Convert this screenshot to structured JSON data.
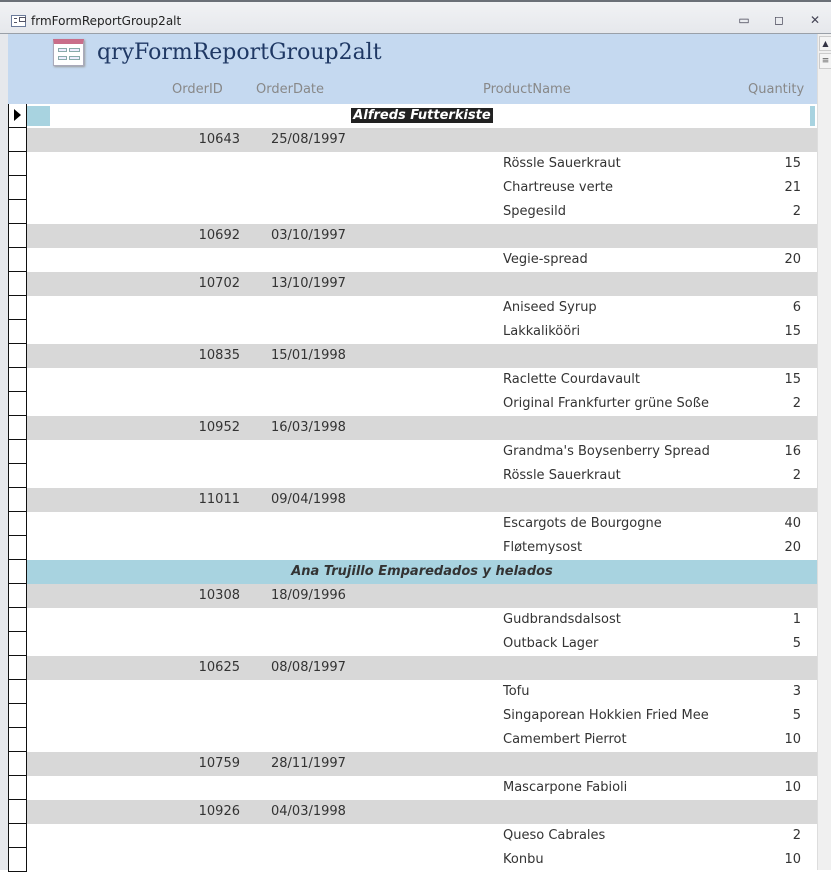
{
  "window": {
    "title": "frmFormReportGroup2alt",
    "minimize": "▭",
    "restore": "◻",
    "close": "✕"
  },
  "header": {
    "title": "qryFormReportGroup2alt",
    "columns": {
      "order_id": "OrderID",
      "order_date": "OrderDate",
      "product": "ProductName",
      "quantity": "Quantity"
    }
  },
  "rows": [
    {
      "type": "customer",
      "name": "Alfreds Futterkiste",
      "active": true
    },
    {
      "type": "order",
      "id": "10643",
      "date": "25/08/1997"
    },
    {
      "type": "detail",
      "product": "Rössle Sauerkraut",
      "qty": "15"
    },
    {
      "type": "detail",
      "product": "Chartreuse verte",
      "qty": "21"
    },
    {
      "type": "detail",
      "product": "Spegesild",
      "qty": "2"
    },
    {
      "type": "order",
      "id": "10692",
      "date": "03/10/1997"
    },
    {
      "type": "detail",
      "product": "Vegie-spread",
      "qty": "20"
    },
    {
      "type": "order",
      "id": "10702",
      "date": "13/10/1997"
    },
    {
      "type": "detail",
      "product": "Aniseed Syrup",
      "qty": "6"
    },
    {
      "type": "detail",
      "product": "Lakkalikööri",
      "qty": "15"
    },
    {
      "type": "order",
      "id": "10835",
      "date": "15/01/1998"
    },
    {
      "type": "detail",
      "product": "Raclette Courdavault",
      "qty": "15"
    },
    {
      "type": "detail",
      "product": "Original Frankfurter grüne Soße",
      "qty": "2"
    },
    {
      "type": "order",
      "id": "10952",
      "date": "16/03/1998"
    },
    {
      "type": "detail",
      "product": "Grandma's Boysenberry Spread",
      "qty": "16"
    },
    {
      "type": "detail",
      "product": "Rössle Sauerkraut",
      "qty": "2"
    },
    {
      "type": "order",
      "id": "11011",
      "date": "09/04/1998"
    },
    {
      "type": "detail",
      "product": "Escargots de Bourgogne",
      "qty": "40"
    },
    {
      "type": "detail",
      "product": "Fløtemysost",
      "qty": "20"
    },
    {
      "type": "customer",
      "name": "Ana Trujillo Emparedados y helados",
      "active": false
    },
    {
      "type": "order",
      "id": "10308",
      "date": "18/09/1996"
    },
    {
      "type": "detail",
      "product": "Gudbrandsdalsost",
      "qty": "1"
    },
    {
      "type": "detail",
      "product": "Outback Lager",
      "qty": "5"
    },
    {
      "type": "order",
      "id": "10625",
      "date": "08/08/1997"
    },
    {
      "type": "detail",
      "product": "Tofu",
      "qty": "3"
    },
    {
      "type": "detail",
      "product": "Singaporean Hokkien Fried Mee",
      "qty": "5"
    },
    {
      "type": "detail",
      "product": "Camembert Pierrot",
      "qty": "10"
    },
    {
      "type": "order",
      "id": "10759",
      "date": "28/11/1997"
    },
    {
      "type": "detail",
      "product": "Mascarpone Fabioli",
      "qty": "10"
    },
    {
      "type": "order",
      "id": "10926",
      "date": "04/03/1998"
    },
    {
      "type": "detail",
      "product": "Queso Cabrales",
      "qty": "2"
    },
    {
      "type": "detail",
      "product": "Konbu",
      "qty": "10"
    }
  ]
}
